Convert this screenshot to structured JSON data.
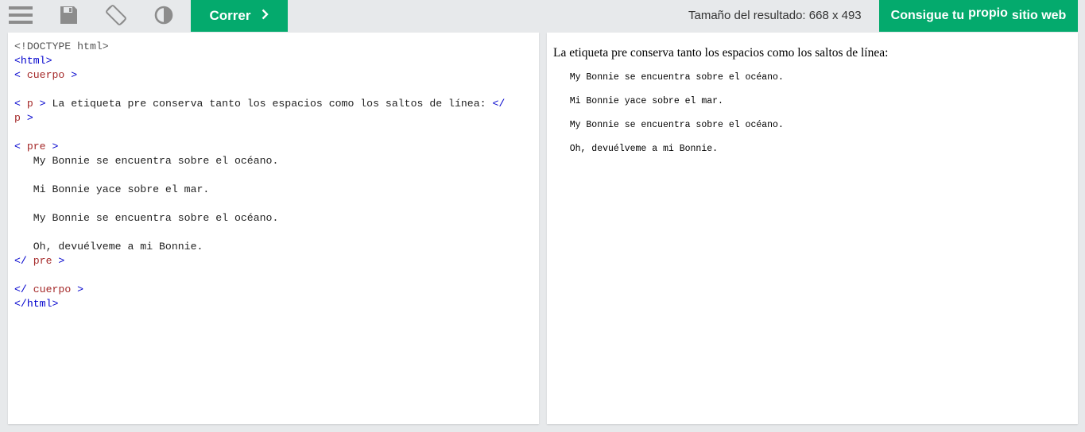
{
  "toolbar": {
    "menu_icon": "hamburger-menu-icon",
    "save_icon": "floppy-disk-icon",
    "rotate_icon": "rotate-screen-icon",
    "theme_icon": "contrast-icon",
    "run_label": "Correr",
    "run_icon": "chevron-right-icon",
    "result_size_label": "Tamaño del resultado: 668 x 493",
    "own_site_part1": "Consigue tu",
    "own_site_part2": "propio",
    "own_site_part3": "sitio web"
  },
  "editor": {
    "lines": [
      {
        "doctype": "<!DOCTYPE html>"
      },
      {
        "tag": "<html>"
      },
      {
        "open": "< ",
        "name": "cuerpo",
        "close": " >"
      },
      {},
      {
        "open": "< ",
        "name": "p",
        "close": " >",
        "text": " La etiqueta pre conserva tanto los espacios como los saltos de línea: ",
        "end_open": "</"
      },
      {
        "name": "p",
        "close": " >"
      },
      {},
      {
        "open": "< ",
        "name": "pre",
        "close": " >"
      },
      {
        "text": "   My Bonnie se encuentra sobre el océano."
      },
      {},
      {
        "text": "   Mi Bonnie yace sobre el mar."
      },
      {},
      {
        "text": "   My Bonnie se encuentra sobre el océano."
      },
      {},
      {
        "text": "   Oh, devuélveme a mi Bonnie."
      },
      {
        "open": "</ ",
        "name": "pre",
        "close": " >"
      },
      {},
      {
        "open": "</ ",
        "name": "cuerpo",
        "close": " >"
      },
      {
        "tag": "</html>"
      }
    ]
  },
  "result": {
    "paragraph": "La etiqueta pre conserva tanto los espacios como los saltos de línea:",
    "pre_lines": [
      "   My Bonnie se encuentra sobre el océano.",
      "",
      "   Mi Bonnie yace sobre el mar.",
      "",
      "   My Bonnie se encuentra sobre el océano.",
      "",
      "   Oh, devuélveme a mi Bonnie."
    ]
  },
  "colors": {
    "accent": "#04aa6d",
    "tag": "#0000cd",
    "tag_name": "#a52a2a",
    "background": "#e7e9eb"
  }
}
